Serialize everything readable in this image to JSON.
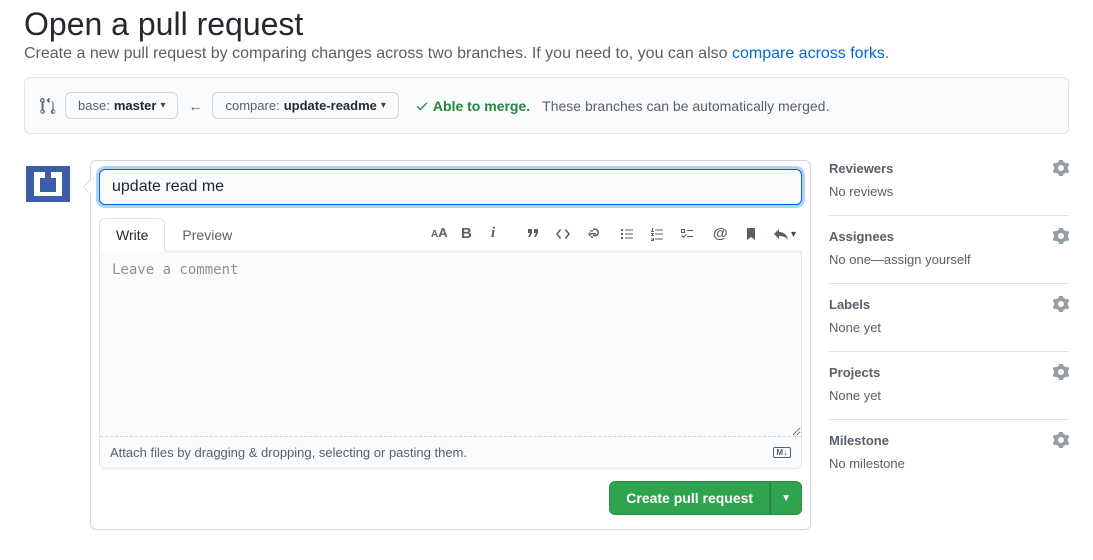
{
  "header": {
    "title": "Open a pull request",
    "subtitle_text": "Create a new pull request by comparing changes across two branches. If you need to, you can also ",
    "subtitle_link": "compare across forks",
    "subtitle_period": "."
  },
  "compare": {
    "base_label": "base:",
    "base_value": "master",
    "compare_label": "compare:",
    "compare_value": "update-readme",
    "able_text": "Able to merge.",
    "able_hint": "These branches can be automatically merged."
  },
  "form": {
    "title_value": "update read me",
    "tab_write": "Write",
    "tab_preview": "Preview",
    "comment_placeholder": "Leave a comment",
    "attach_hint": "Attach files by dragging & dropping, selecting or pasting them.",
    "submit_label": "Create pull request"
  },
  "sidebar": {
    "reviewers": {
      "title": "Reviewers",
      "text": "No reviews"
    },
    "assignees": {
      "title": "Assignees",
      "text_prefix": "No one—",
      "link": "assign yourself"
    },
    "labels": {
      "title": "Labels",
      "text": "None yet"
    },
    "projects": {
      "title": "Projects",
      "text": "None yet"
    },
    "milestone": {
      "title": "Milestone",
      "text": "No milestone"
    }
  }
}
